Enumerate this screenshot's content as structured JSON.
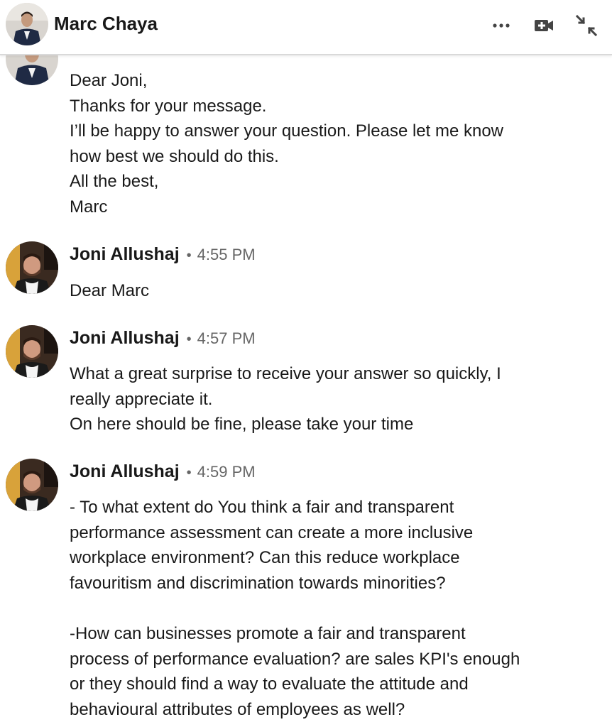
{
  "header": {
    "name": "Marc Chaya"
  },
  "icons": {
    "more": "more-icon",
    "video": "video-call-icon",
    "minimize": "minimize-icon"
  },
  "messages": [
    {
      "text": "Dear Joni,\nThanks for your message.\nI’ll be happy to answer your question. Please let me know\nhow best we should do this.\nAll the best,\nMarc"
    },
    {
      "sender": "Joni Allushaj",
      "time": "4:55 PM",
      "text": "Dear Marc"
    },
    {
      "sender": "Joni Allushaj",
      "time": "4:57 PM",
      "text": "What a great surprise to receive your answer so quickly, I\nreally appreciate it.\nOn here should be fine, please take your time"
    },
    {
      "sender": "Joni Allushaj",
      "time": "4:59 PM",
      "text": "- To what extent do You think a fair and transparent\nperformance assessment can create a more inclusive\nworkplace environment? Can this reduce workplace\nfavouritism and discrimination towards minorities?\n\n-How can businesses promote a fair and transparent\nprocess of performance evaluation? are sales KPI's enough\nor they should find a way to evaluate the attitude and\nbehavioural attributes of employees as well?"
    }
  ]
}
